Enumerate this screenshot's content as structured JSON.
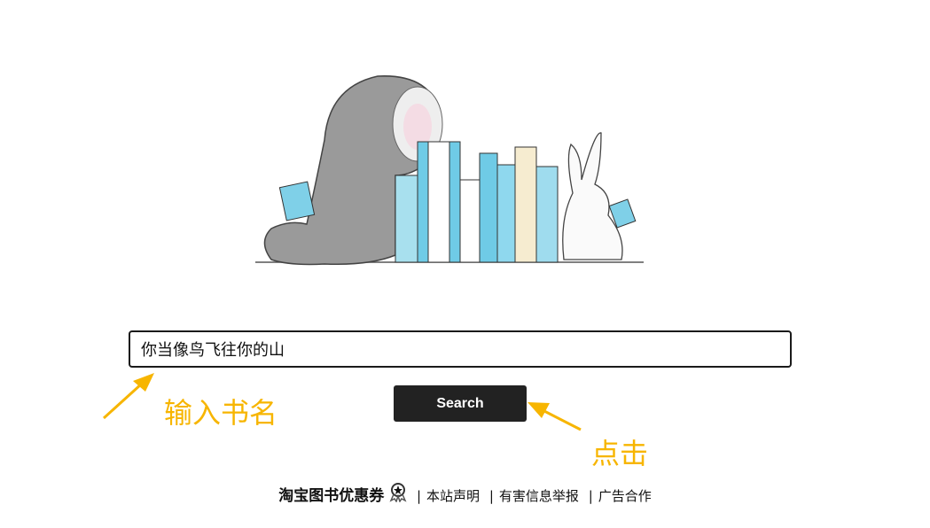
{
  "search": {
    "value": "你当像鸟飞往你的山",
    "button_label": "Search"
  },
  "annotations": {
    "input_hint": "输入书名",
    "click_hint": "点击",
    "color": "#f7b500"
  },
  "footer": {
    "brand": "淘宝图书优惠券",
    "brand_icon": "award-badge-icon",
    "links": [
      "本站声明",
      "有害信息举报",
      "广告合作"
    ],
    "separator": "|"
  }
}
